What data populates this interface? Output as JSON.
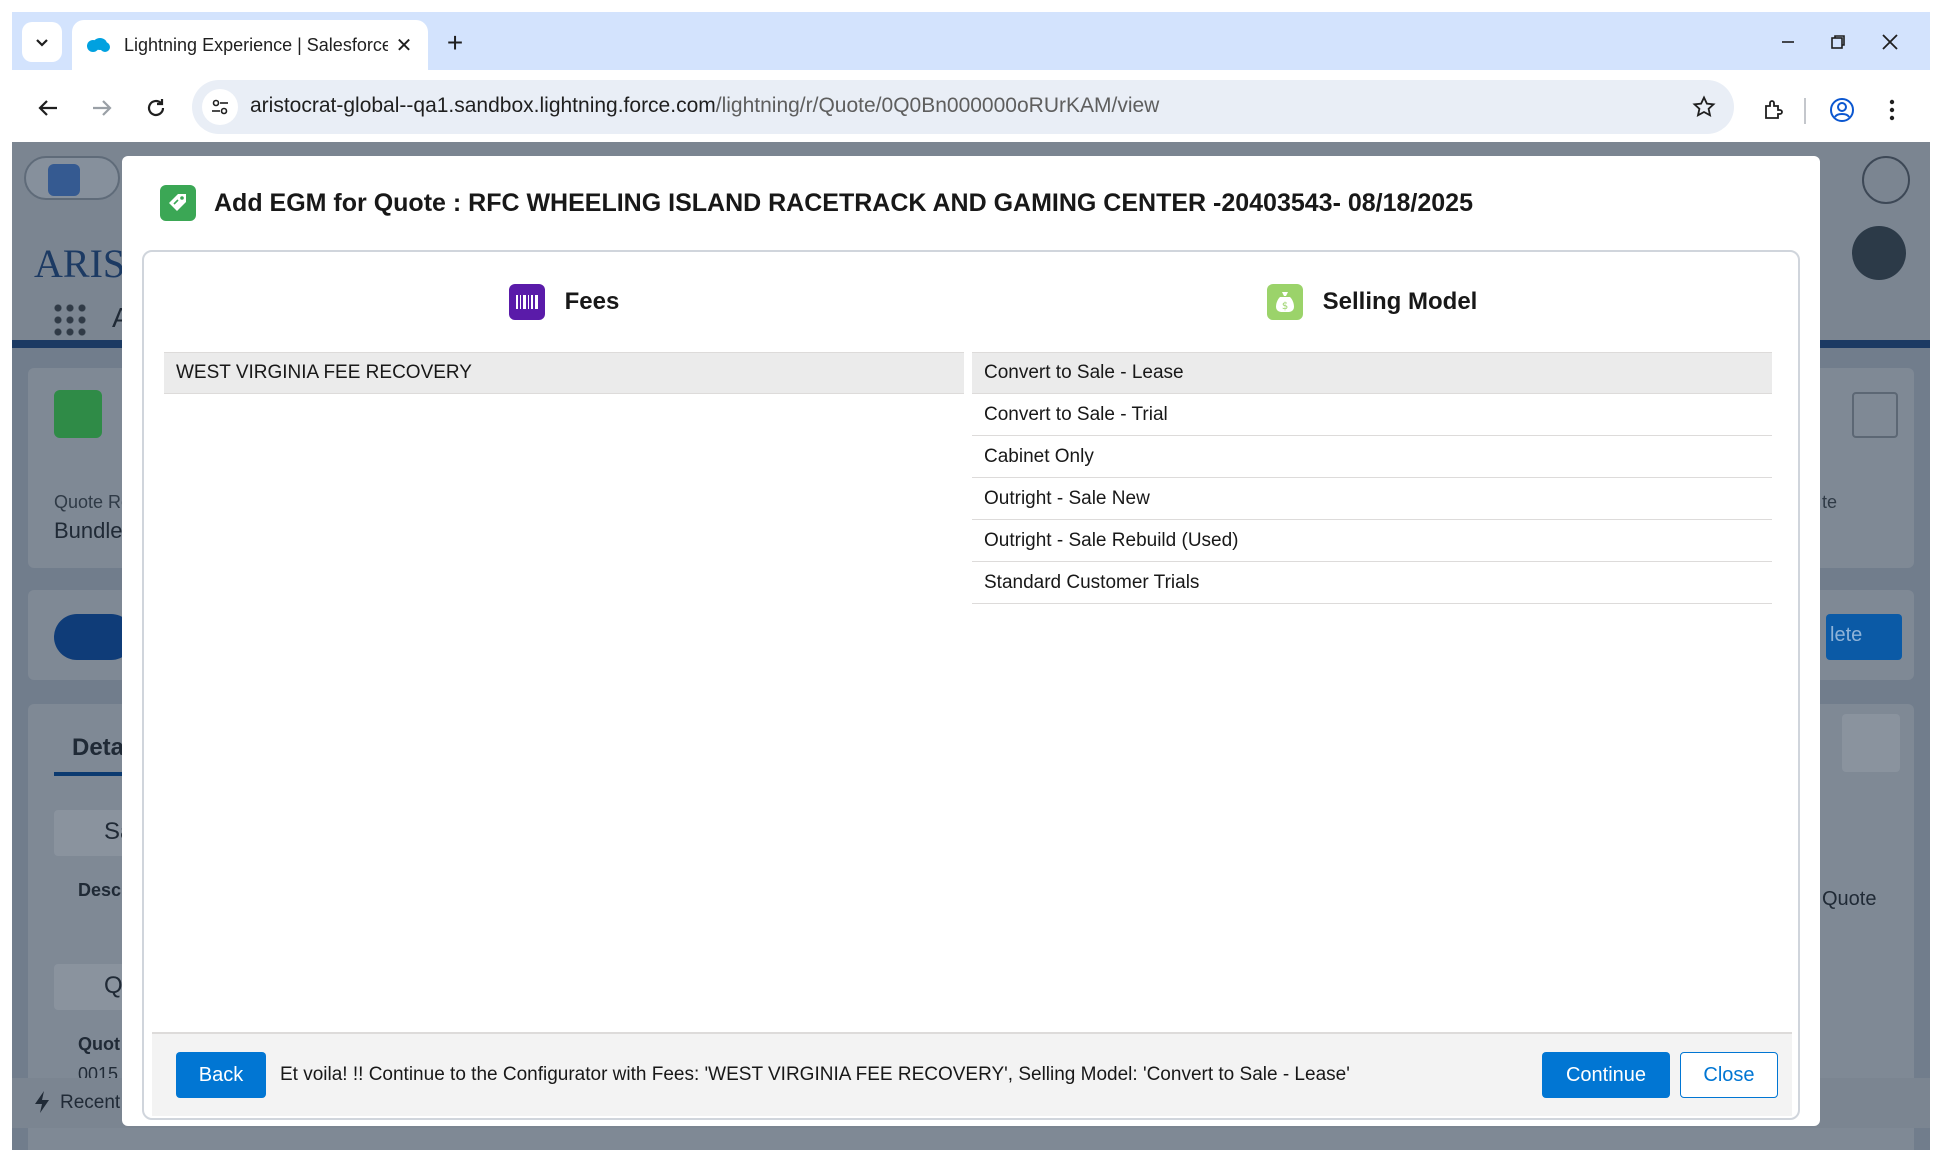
{
  "browser": {
    "tab_title": "Lightning Experience | Salesforce",
    "url_host": "aristocrat-global--qa1.sandbox.lightning.force.com",
    "url_path": "/lightning/r/Quote/0Q0Bn000000oRUrKAM/view",
    "new_tab_label": "+"
  },
  "background": {
    "logo_text": "ARISTO",
    "app_letter": "A",
    "record_field_label": "Quote Re",
    "record_field_value": "Bundle",
    "delete_fragment": "lete",
    "details_tab": "Deta",
    "section1_letter": "Sa",
    "descr_label": "Descr",
    "section2_letter": "Q",
    "quote_label": "Quot",
    "quote_value": "0015",
    "right_label": "te",
    "right_quote": "Quote",
    "recent_label": "Recent"
  },
  "modal": {
    "title": "Add EGM for Quote : RFC WHEELING ISLAND RACETRACK AND GAMING CENTER -20403543- 08/18/2025",
    "fees": {
      "heading": "Fees",
      "items": [
        "WEST VIRGINIA FEE RECOVERY"
      ]
    },
    "selling_model": {
      "heading": "Selling Model",
      "items": [
        "Convert to Sale - Lease",
        "Convert to Sale - Trial",
        "Cabinet Only",
        "Outright - Sale New",
        "Outright - Sale Rebuild (Used)",
        "Standard Customer Trials"
      ]
    },
    "footer": {
      "back_label": "Back",
      "message": "Et voila! !! Continue to the Configurator with Fees: 'WEST VIRGINIA FEE RECOVERY', Selling Model: 'Convert to Sale - Lease'",
      "continue_label": "Continue",
      "close_label": "Close"
    }
  },
  "colors": {
    "brand": "#0176d3",
    "quote_icon": "#3ba755",
    "fees_icon": "#5a1ba9",
    "selling_icon": "#9bd36a"
  }
}
